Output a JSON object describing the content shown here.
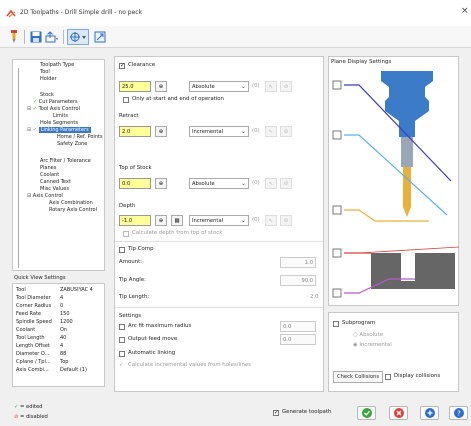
{
  "window": {
    "title": "2D Toolpaths - Drill Simple drill - no peck",
    "close": "×"
  },
  "tree": {
    "items": [
      {
        "label": "Toolpath Type",
        "indent": 0
      },
      {
        "label": "Tool",
        "indent": 0
      },
      {
        "label": "Holder",
        "indent": 0
      },
      {
        "label": "Stock",
        "indent": 0
      },
      {
        "label": "Cut Parameters",
        "indent": 0
      },
      {
        "label": "Tool Axis Control",
        "indent": 0
      },
      {
        "label": "Limits",
        "indent": 1
      },
      {
        "label": "Hole Segments",
        "indent": 0
      },
      {
        "label": "Linking Parameters",
        "indent": 0
      },
      {
        "label": "Home / Ref. Points",
        "indent": 1
      },
      {
        "label": "Safety Zone",
        "indent": 1
      },
      {
        "label": "Arc Filter / Tolerance",
        "indent": 0
      },
      {
        "label": "Planes",
        "indent": 0
      },
      {
        "label": "Coolant",
        "indent": 0
      },
      {
        "label": "Canned Text",
        "indent": 0
      },
      {
        "label": "Misc Values",
        "indent": 0
      },
      {
        "label": "Axis Control",
        "indent": 0
      },
      {
        "label": "Axis Combination",
        "indent": 1
      },
      {
        "label": "Rotary Axis Control",
        "indent": 1
      }
    ]
  },
  "quick_view": {
    "title": "Quick View Settings",
    "rows": [
      {
        "k": "Tool",
        "v": "ZABUSIYAC 4"
      },
      {
        "k": "Tool Diameter",
        "v": "4"
      },
      {
        "k": "Corner Radius",
        "v": "0"
      },
      {
        "k": "Feed Rate",
        "v": "150"
      },
      {
        "k": "Spindle Speed",
        "v": "1200"
      },
      {
        "k": "Coolant",
        "v": "On"
      },
      {
        "k": "Tool Length",
        "v": "40"
      },
      {
        "k": "Length Offset",
        "v": "4"
      },
      {
        "k": "Diameter O...",
        "v": "88"
      },
      {
        "k": "Cplane / Tpl...",
        "v": "Top"
      },
      {
        "k": "Axis Combi...",
        "v": "Default (1)"
      }
    ]
  },
  "legend": {
    "edited": "= edited",
    "disabled": "= disabled"
  },
  "clearance": {
    "label": "Clearance",
    "value": "25.0",
    "mode": "Absolute",
    "sub": "(0)",
    "only_start_end": "Only at start and end of operation"
  },
  "retract": {
    "label": "Retract",
    "value": "2.0",
    "mode": "Incremental",
    "sub": "(0)"
  },
  "top_of_stock": {
    "label": "Top of Stock",
    "value": "0.0",
    "mode": "Absolute",
    "sub": "(0)"
  },
  "depth": {
    "label": "Depth",
    "value": "-1.0",
    "mode": "Incremental",
    "sub": "(0)",
    "calc": "Calculate depth from top of stock"
  },
  "tip_comp": {
    "label": "Tip Comp",
    "amount_label": "Amount:",
    "amount": "1.0",
    "angle_label": "Tip Angle:",
    "angle": "90.0",
    "length_label": "Tip Length:",
    "length": "2.0"
  },
  "settings": {
    "label": "Settings",
    "arc_fit": "Arc fit maximum radius",
    "arc_fit_value": "0.0",
    "output_feed": "Output feed move",
    "output_feed_value": "0.0",
    "auto_linking": "Automatic linking",
    "calc_incremental": "Calculate incremental values from holes/lines"
  },
  "plane_display": {
    "title": "Plane Display Settings"
  },
  "subprogram": {
    "label": "Subprogram",
    "absolute": "Absolute",
    "incremental": "Incremental"
  },
  "buttons": {
    "check_collisions": "Check Collisions",
    "display_collisions": "Display collisions",
    "generate": "Generate toolpath"
  },
  "colors": {
    "accent": "#3a78c3",
    "ok": "#3aa33a",
    "cancel": "#d9413b",
    "help": "#2f6fc4"
  }
}
